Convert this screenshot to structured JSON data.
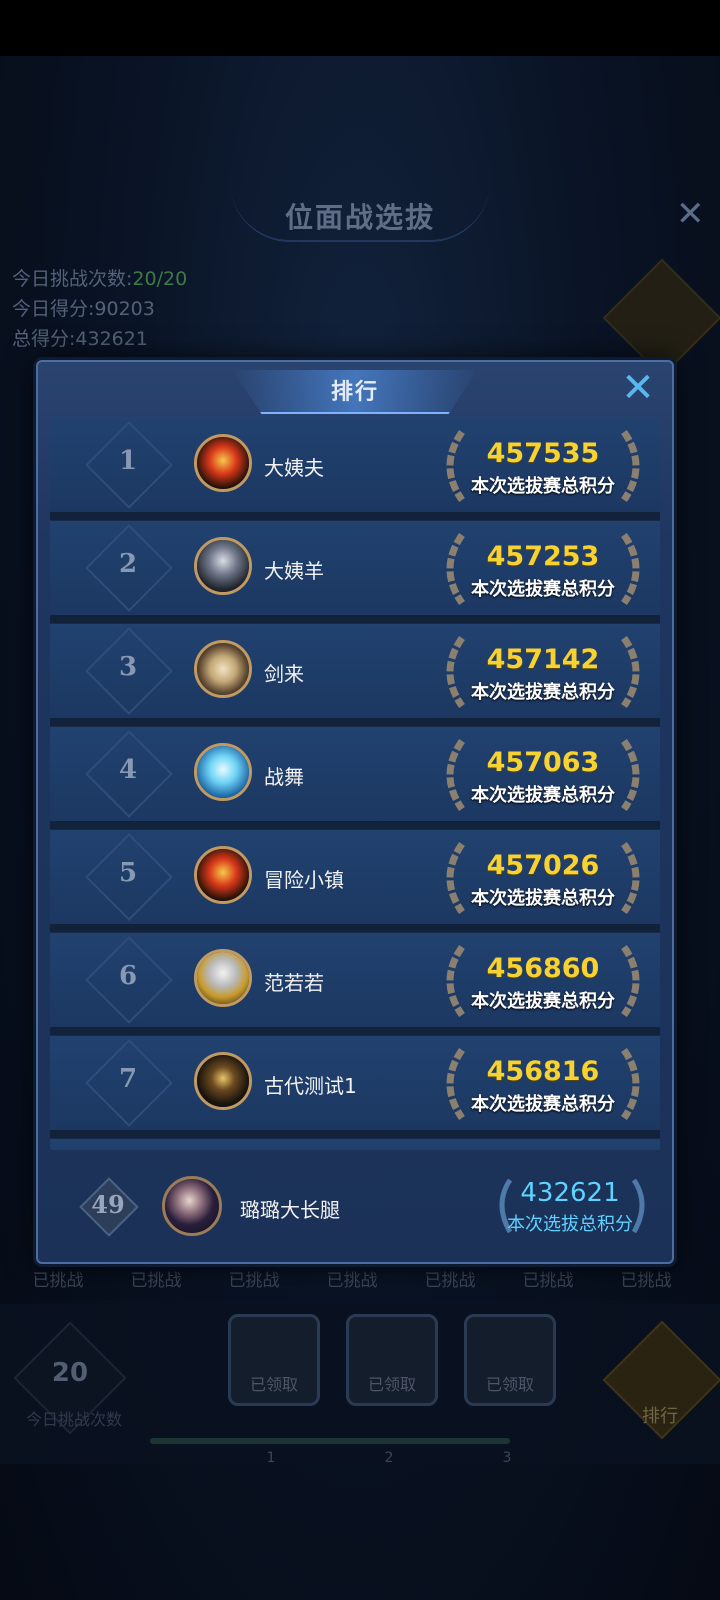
{
  "background": {
    "title": "位面战选拔",
    "stats": [
      {
        "label": "今日挑战次数:",
        "value": "20/20"
      },
      {
        "label": "今日得分:",
        "value": "90203"
      },
      {
        "label": "总得分:",
        "value": "432621"
      }
    ],
    "challenged_labels": [
      "已挑战",
      "已挑战",
      "已挑战",
      "已挑战",
      "已挑战",
      "已挑战",
      "已挑战"
    ],
    "today_count": "20",
    "today_count_label": "今日挑战次数",
    "chests": [
      {
        "label": "已领取",
        "index": "1"
      },
      {
        "label": "已领取",
        "index": "2"
      },
      {
        "label": "已领取",
        "index": "3"
      }
    ],
    "rank_button_label": "排行"
  },
  "modal": {
    "title": "排行",
    "score_label": "本次选拔赛总积分",
    "rows": [
      {
        "rank": "1",
        "name": "大姨夫",
        "score": "457535",
        "avatar": "flame-demon-avatar"
      },
      {
        "rank": "2",
        "name": "大姨羊",
        "score": "457253",
        "avatar": "silver-warrior-avatar"
      },
      {
        "rank": "3",
        "name": "剑来",
        "score": "457142",
        "avatar": "hat-swordsman-avatar"
      },
      {
        "rank": "4",
        "name": "战舞",
        "score": "457063",
        "avatar": "ice-spirit-avatar"
      },
      {
        "rank": "5",
        "name": "冒险小镇",
        "score": "457026",
        "avatar": "flame-demon-avatar"
      },
      {
        "rank": "6",
        "name": "范若若",
        "score": "456860",
        "avatar": "white-hair-avatar"
      },
      {
        "rank": "7",
        "name": "古代测试1",
        "score": "456816",
        "avatar": "dark-knight-avatar"
      }
    ],
    "me": {
      "rank": "49",
      "name": "璐璐大长腿",
      "score": "432621",
      "score_label": "本次选拔总积分"
    }
  },
  "colors": {
    "score_gold": "#f7d233",
    "my_score_cyan": "#5ed3ff",
    "modal_bg": "#1e3660",
    "close_blue": "#58b7f0"
  }
}
